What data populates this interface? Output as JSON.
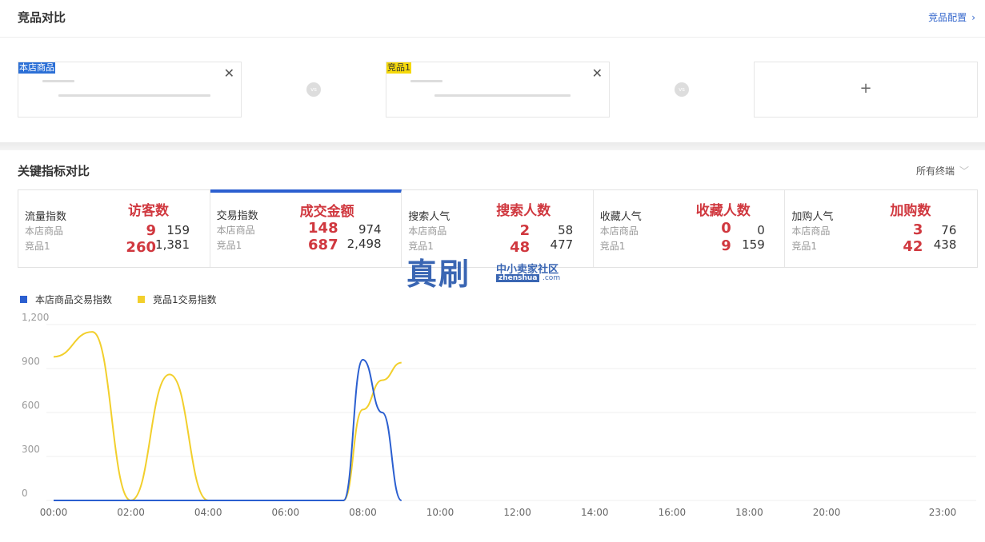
{
  "header": {
    "title": "竞品对比",
    "config_label": "竞品配置",
    "config_icon": "chevron-right-icon"
  },
  "compare": {
    "own_tag": "本店商品",
    "competitor_tag": "竞品1",
    "close_icon": "close-icon",
    "vs_label": "vs",
    "add_icon": "plus-icon",
    "add_label": "+"
  },
  "key_metrics": {
    "title": "关键指标对比",
    "terminal_select": "所有终端",
    "row_labels": [
      "本店商品",
      "竞品1"
    ],
    "items": [
      {
        "name": "流量指数",
        "annotation": "访客数",
        "own_big": "9",
        "own_small": "159",
        "comp_big": "260",
        "comp_small": "1,381",
        "active": false
      },
      {
        "name": "交易指数",
        "annotation": "成交金额",
        "own_big": "148",
        "own_small": "974",
        "comp_big": "687",
        "comp_small": "2,498",
        "active": true
      },
      {
        "name": "搜索人气",
        "annotation": "搜索人数",
        "own_big": "2",
        "own_small": "58",
        "comp_big": "48",
        "comp_small": "477",
        "active": false
      },
      {
        "name": "收藏人气",
        "annotation": "收藏人数",
        "own_big": "0",
        "own_small": "0",
        "comp_big": "9",
        "comp_small": "159",
        "active": false
      },
      {
        "name": "加购人气",
        "annotation": "加购数",
        "own_big": "3",
        "own_small": "76",
        "comp_big": "42",
        "comp_small": "438",
        "active": false
      }
    ]
  },
  "watermark": {
    "big": "真刷",
    "small": "中小卖家社区",
    "domain": "zhenshua",
    "suffix": ".com"
  },
  "colors": {
    "own": "#2b5fd0",
    "competitor": "#f2cf2c",
    "accent": "#3366cc",
    "annotation": "#d0383f"
  },
  "chart_data": {
    "type": "line",
    "x": [
      "00:00",
      "01:00",
      "02:00",
      "03:00",
      "04:00",
      "05:00",
      "06:00",
      "07:00",
      "07:30",
      "08:00",
      "08:30",
      "09:00"
    ],
    "x_ticks": [
      "00:00",
      "02:00",
      "04:00",
      "06:00",
      "08:00",
      "10:00",
      "12:00",
      "14:00",
      "16:00",
      "18:00",
      "20:00",
      "23:00"
    ],
    "series": [
      {
        "name": "本店商品交易指数",
        "values": [
          0,
          0,
          0,
          0,
          0,
          0,
          0,
          0,
          0,
          960,
          600,
          0
        ]
      },
      {
        "name": "竞品1交易指数",
        "values": [
          980,
          1150,
          0,
          860,
          0,
          0,
          0,
          0,
          0,
          620,
          820,
          940
        ]
      }
    ],
    "y_ticks": [
      "0",
      "300",
      "600",
      "900",
      "1,200"
    ],
    "ylim": [
      0,
      1200
    ],
    "grid": true,
    "legend": "top-left"
  }
}
